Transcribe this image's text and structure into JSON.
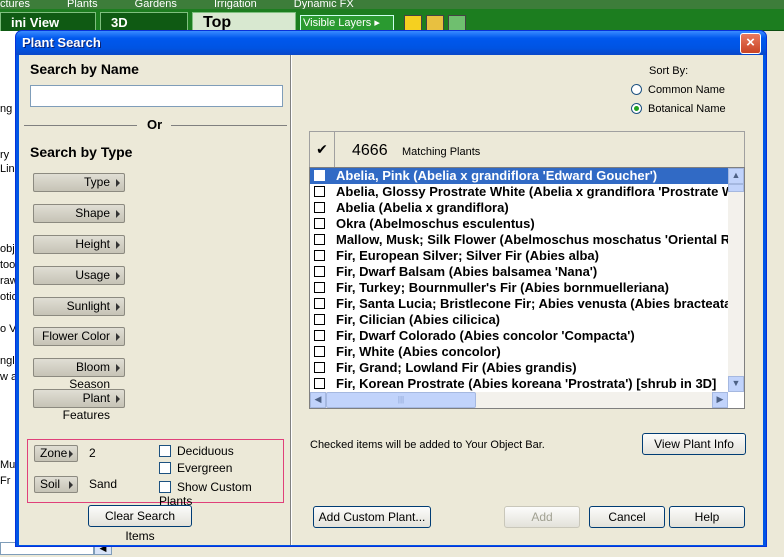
{
  "background": {
    "menu_items": [
      "ctures",
      "Plants",
      "Gardens",
      "Irrigation",
      "Dynamic FX"
    ],
    "tabs": [
      "ini View",
      "3D",
      "Top"
    ],
    "visible_layers": "Visible Layers",
    "left_fragments": [
      "ng",
      "ry",
      "Lin",
      "obje",
      "too",
      "raw",
      "otio",
      "o V",
      "ngle",
      "w a",
      "Mu",
      "Fr"
    ]
  },
  "dialog": {
    "title": "Plant Search",
    "close_label": "×",
    "search_by_name": "Search by Name",
    "name_value": "",
    "or_label": "Or",
    "search_by_type": "Search by Type",
    "type_buttons": [
      "Type",
      "Shape",
      "Height",
      "Usage",
      "Sunlight",
      "Flower Color",
      "Bloom Season",
      "Plant Features"
    ],
    "zone": {
      "label": "Zone",
      "value": "2"
    },
    "soil": {
      "label": "Soil",
      "value": "Sand"
    },
    "filters": [
      {
        "label": "Deciduous",
        "checked": false
      },
      {
        "label": "Evergreen",
        "checked": false
      },
      {
        "label": "Show Custom Plants",
        "checked": false
      }
    ],
    "clear_button": "Clear Search Items",
    "sort_by": {
      "label": "Sort By:",
      "options": [
        {
          "label": "Common Name",
          "selected": false
        },
        {
          "label": "Botanical Name",
          "selected": true
        }
      ]
    },
    "list": {
      "check_header": "✔",
      "count": "4666",
      "count_label": "Matching Plants",
      "rows": [
        "Abelia, Pink (Abelia x grandiflora 'Edward Goucher')",
        "Abelia, Glossy Prostrate White (Abelia x grandiflora 'Prostrate White')",
        "Abelia (Abelia x grandiflora)",
        "Okra (Abelmoschus esculentus)",
        "Mallow, Musk; Silk Flower (Abelmoschus moschatus 'Oriental Red')",
        "Fir, European Silver; Silver Fir (Abies alba)",
        "Fir, Dwarf Balsam (Abies balsamea 'Nana')",
        "Fir, Turkey; Bournmuller's Fir (Abies bornmuelleriana)",
        "Fir, Santa Lucia; Bristlecone Fir; Abies venusta (Abies bracteata)",
        "Fir, Cilician (Abies cilicica)",
        "Fir, Dwarf Colorado (Abies concolor 'Compacta')",
        "Fir, White (Abies concolor)",
        "Fir, Grand; Lowland Fir (Abies grandis)",
        "Fir, Korean Prostrate (Abies koreana 'Prostrata') [shrub in 3D]"
      ],
      "selected_index": 0
    },
    "checked_note": "Checked items will be added to Your Object Bar.",
    "view_info_button": "View Plant Info",
    "add_custom_button": "Add Custom Plant...",
    "add_button": "Add",
    "cancel_button": "Cancel",
    "help_button": "Help"
  }
}
